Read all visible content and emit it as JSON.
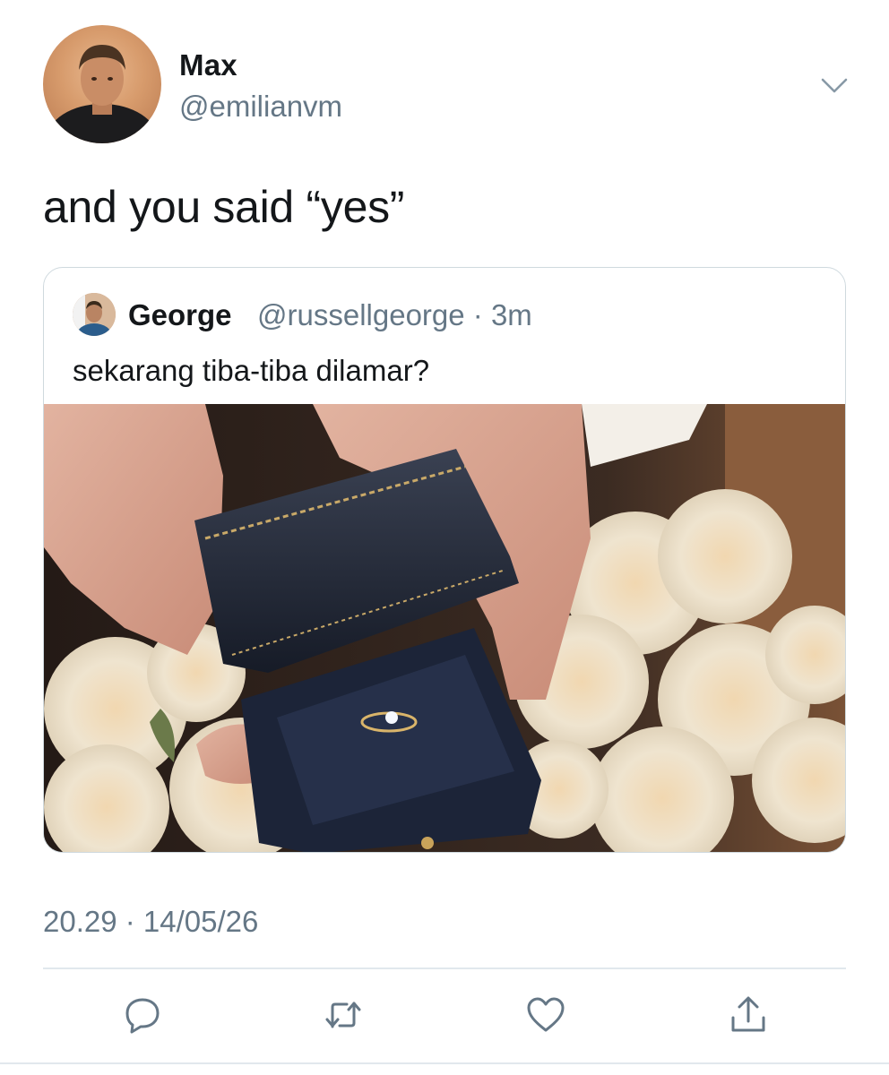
{
  "author": {
    "name": "Max",
    "handle": "@emilianvm"
  },
  "tweet": {
    "text": "and you said “yes”",
    "timestamp": "20.29 · 14/05/26"
  },
  "quoted_tweet": {
    "name": "George",
    "handle_time": "@russellgeorge · 3m",
    "text": "sekarang tiba-tiba dilamar?"
  },
  "icons": {
    "menu": "chevron-down-icon",
    "reply": "reply-icon",
    "retweet": "retweet-icon",
    "like": "heart-icon",
    "share": "share-icon"
  },
  "colors": {
    "secondary_text": "#657786",
    "icon": "#657786",
    "border": "#cfd9de"
  }
}
